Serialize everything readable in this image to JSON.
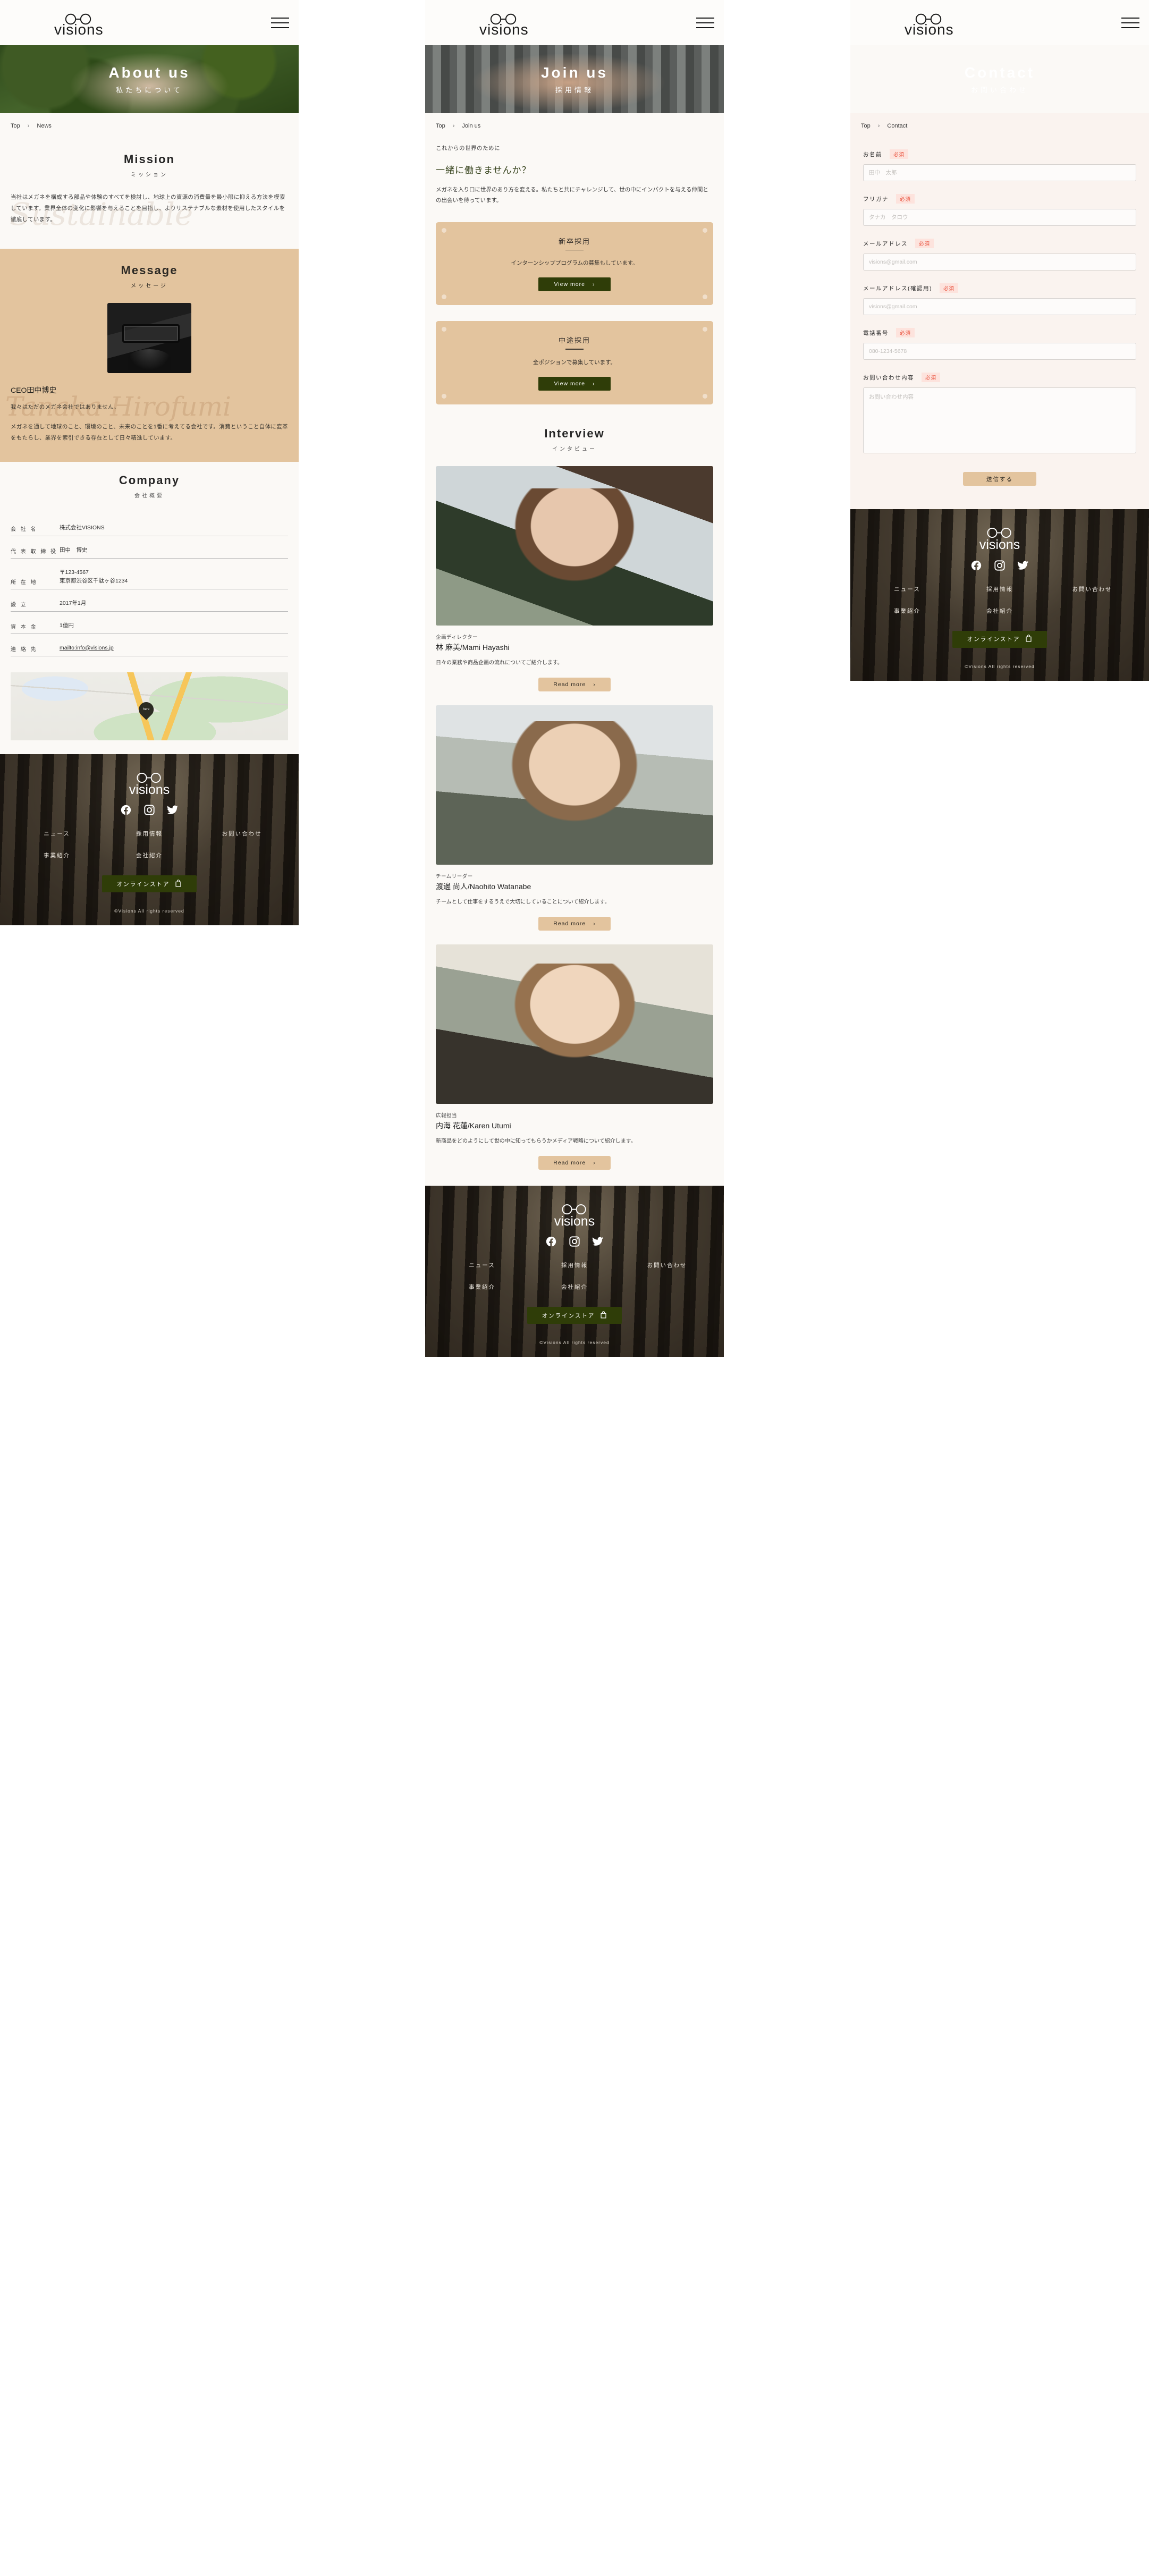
{
  "brand": {
    "name": "visions",
    "logo_icon": "glasses-logo-icon"
  },
  "header": {
    "menu_icon": "hamburger-menu-icon"
  },
  "pages": {
    "about": {
      "hero": {
        "title": "About us",
        "subtitle": "私たちについて",
        "image": "hands-holding-soil-photo"
      },
      "breadcrumb": {
        "home": "Top",
        "separator": "›",
        "current": "News"
      },
      "mission": {
        "title": "Mission",
        "subtitle": "ミッション",
        "watermark": "Sustainable",
        "body": "当社はメガネを構成する部品や体験のすべてを検討し、地球上の資源の消費量を最小限に抑える方法を模索しています。業界全体の変化に影響を与えることを目指し、よりサステナブルな素材を使用したスタイルを徹底しています。"
      },
      "message": {
        "title": "Message",
        "subtitle": "メッセージ",
        "watermark": "Tanaka Hirofumi",
        "portrait_alt": "ceo-portrait",
        "ceo_name": "CEO田中博史",
        "lead": "我々はただのメガネ会社ではありません。",
        "body": "メガネを通して地球のこと、環境のこと、未来のことを1番に考えてる会社です。消費ということ自体に変革をもたらし、業界を索引できる存在として日々精進しています。"
      },
      "company": {
        "title": "Company",
        "subtitle": "会社概要",
        "rows": [
          {
            "label": "会 社 名",
            "value": "株式会社VISIONS"
          },
          {
            "label": "代 表 取 締 役",
            "value": "田中　博史"
          },
          {
            "label": "所 在 地",
            "value": "〒123-4567\n東京都渋谷区千駄ヶ谷1234"
          },
          {
            "label": "設 立",
            "value": "2017年1月"
          },
          {
            "label": "資 本 金",
            "value": "1億円"
          },
          {
            "label": "連 絡 先",
            "value": "mailto:info@visions.jp"
          }
        ],
        "map": {
          "pin_label": "here",
          "alt": "office-location-map"
        }
      }
    },
    "join": {
      "hero": {
        "title": "Join us",
        "subtitle": "採用情報",
        "image": "two-hands-reaching-photo"
      },
      "breadcrumb": {
        "home": "Top",
        "separator": "›",
        "current": "Join us"
      },
      "intro": {
        "kicker": "これからの世界のために",
        "heading": "一緒に働きませんか？",
        "body": "メガネを入り口に世界のあり方を変える。私たちと共にチャレンジして、世の中にインパクトを与える仲間との出会いを待っています。"
      },
      "recruit_cards": [
        {
          "title": "新卒採用",
          "desc": "インターンシッププログラムの募集もしています。",
          "button": "View more",
          "arrow": "›"
        },
        {
          "title": "中途採用",
          "desc": "全ポジションで募集しています。",
          "button": "View more",
          "arrow": "›"
        }
      ],
      "interview": {
        "title": "Interview",
        "subtitle": "インタビュー",
        "items": [
          {
            "photo": "woman-with-glasses-portrait",
            "role": "企画ディレクター",
            "name": "林 麻美/Mami Hayashi",
            "desc": "日々の業務や商品企画の流れについてご紹介します。",
            "button": "Read more",
            "arrow": "›"
          },
          {
            "photo": "man-with-glasses-portrait",
            "role": "チームリーダー",
            "name": "渡邊 尚人/Naohito Watanabe",
            "desc": "チームとして仕事をするうえで大切にしていることについて紹介します。",
            "button": "Read more",
            "arrow": "›"
          },
          {
            "photo": "smiling-woman-portrait",
            "role": "広報担当",
            "name": "内海 花蓮/Karen Utumi",
            "desc": "新商品をどのようにして世の中に知ってもらうかメディア戦略について紹介します。",
            "button": "Read more",
            "arrow": "›"
          }
        ]
      }
    },
    "contact": {
      "hero": {
        "title": "Contact",
        "subtitle": "お問い合わせ",
        "image": "hands-on-laptop-photo"
      },
      "breadcrumb": {
        "home": "Top",
        "separator": "›",
        "current": "Contact"
      },
      "form": {
        "required_badge": "必須",
        "fields": [
          {
            "label": "お名前",
            "placeholder": "田中　太郎",
            "value": "",
            "type": "text",
            "name": "name-field"
          },
          {
            "label": "フリガナ",
            "placeholder": "タナカ　タロウ",
            "value": "",
            "type": "text",
            "name": "furigana-field"
          },
          {
            "label": "メールアドレス",
            "placeholder": "visions@gmail.com",
            "value": "",
            "type": "email",
            "name": "email-field"
          },
          {
            "label": "メールアドレス(確認用)",
            "placeholder": "visions@gmail.com",
            "value": "",
            "type": "email",
            "name": "email-confirm-field"
          },
          {
            "label": "電話番号",
            "placeholder": "080-1234-5678",
            "value": "",
            "type": "tel",
            "name": "phone-field"
          }
        ],
        "message_field": {
          "label": "お問い合わせ内容",
          "placeholder": "お問い合わせ内容",
          "value": ""
        },
        "submit": "送信する"
      }
    }
  },
  "footer": {
    "socials": [
      {
        "name": "facebook-icon"
      },
      {
        "name": "instagram-icon"
      },
      {
        "name": "twitter-icon"
      }
    ],
    "nav": [
      "ニュース",
      "採用情報",
      "お問い合わせ",
      "事業紹介",
      "会社紹介",
      ""
    ],
    "store_button": "オンラインストア",
    "store_icon": "shopping-bag-icon",
    "copyright": "©Visions All rights reserved",
    "background": "dark-forest-photo"
  },
  "colors": {
    "tan": "#e3c49e",
    "green": "#2f3d08",
    "cream": "#fbf9f6",
    "pink_cream": "#faf3ef",
    "required_red": "#e9503c"
  }
}
